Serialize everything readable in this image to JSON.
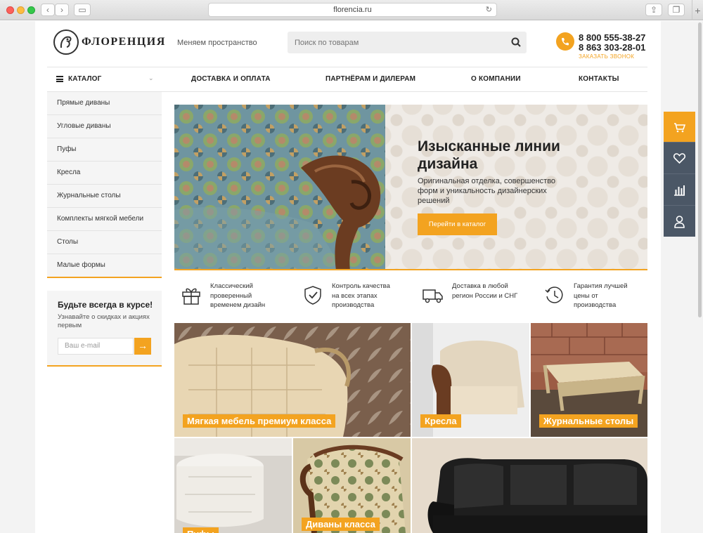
{
  "browser": {
    "url": "florencia.ru"
  },
  "header": {
    "logo_text": "ФЛОРЕНЦИЯ",
    "slogan": "Меняем пространство",
    "search_placeholder": "Поиск по товарам",
    "phone1": "8 800 555-38-27",
    "phone2": "8 863 303-28-01",
    "callback": "ЗАКАЗАТЬ ЗВОНОК"
  },
  "nav": {
    "catalog": "КАТАЛОГ",
    "items": [
      "ДОСТАВКА И ОПЛАТА",
      "ПАРТНЁРАМ И ДИЛЕРАМ",
      "О КОМПАНИИ",
      "КОНТАКТЫ"
    ]
  },
  "sidebar": {
    "items": [
      "Прямые диваны",
      "Угловые диваны",
      "Пуфы",
      "Кресла",
      "Журнальные столы",
      "Комплекты мягкой мебели",
      "Столы",
      "Малые формы"
    ]
  },
  "subscribe": {
    "title": "Будьте всегда в курсе!",
    "text": "Узнавайте о скидках и акциях первым",
    "placeholder": "Ваш e-mail",
    "button": "→"
  },
  "hero": {
    "title": "Изысканные линии дизайна",
    "text": "Оригинальная отделка, совершенство форм и уникальность дизайнерских решений",
    "button": "Перейти в каталог"
  },
  "features": [
    {
      "icon": "gift-icon",
      "text": "Классический проверенный временем дизайн"
    },
    {
      "icon": "shield-check-icon",
      "text": "Контроль качества на всех этапах производства"
    },
    {
      "icon": "truck-icon",
      "text": "Доставка в любой регион России и СНГ"
    },
    {
      "icon": "clock-icon",
      "text": "Гарантия лучшей цены от производства"
    }
  ],
  "tiles": [
    {
      "label": "Мягкая мебель премиум класса",
      "color": "#8a6f58"
    },
    {
      "label": "Кресла",
      "color": "#d9d2c6"
    },
    {
      "label": "Журнальные столы",
      "color": "#a57a5c"
    },
    {
      "label": "Пуфы",
      "color": "#cfcfcf"
    },
    {
      "label": "Диваны класса",
      "color": "#8c7a5a"
    },
    {
      "label": "",
      "color": "#2d2d2d"
    }
  ],
  "colors": {
    "accent": "#f3a320",
    "panel": "#4b5766"
  },
  "right_panel": [
    "cart-icon",
    "heart-icon",
    "chart-icon",
    "user-icon"
  ]
}
